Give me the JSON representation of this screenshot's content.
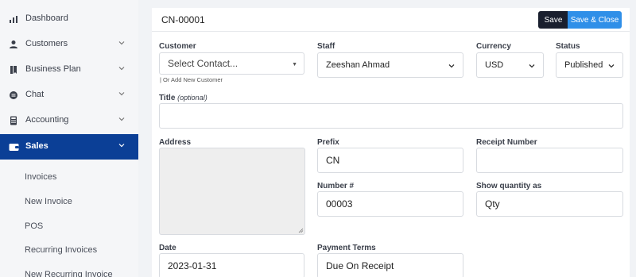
{
  "sidebar": {
    "items": [
      {
        "label": "Dashboard",
        "icon": "bar-chart-icon",
        "has_chevron": false
      },
      {
        "label": "Customers",
        "icon": "user-icon",
        "has_chevron": true
      },
      {
        "label": "Business Plan",
        "icon": "bookmark-icon",
        "has_chevron": true
      },
      {
        "label": "Chat",
        "icon": "chat-icon",
        "has_chevron": true
      },
      {
        "label": "Accounting",
        "icon": "calculator-icon",
        "has_chevron": true
      },
      {
        "label": "Sales",
        "icon": "wallet-icon",
        "has_chevron": true,
        "active": true
      }
    ],
    "sub_items": [
      "Invoices",
      "New Invoice",
      "POS",
      "Recurring Invoices",
      "New Recurring Invoice"
    ]
  },
  "header": {
    "doc_number": "CN-00001",
    "save_label": "Save",
    "save_close_label": "Save & Close"
  },
  "form": {
    "customer": {
      "label": "Customer",
      "placeholder": "Select Contact...",
      "helper": "| Or Add New Customer"
    },
    "staff": {
      "label": "Staff",
      "value": "Zeeshan Ahmad"
    },
    "currency": {
      "label": "Currency",
      "value": "USD"
    },
    "status": {
      "label": "Status",
      "value": "Published"
    },
    "title": {
      "label": "Title",
      "label_suffix": "(optional)",
      "value": ""
    },
    "address": {
      "label": "Address",
      "value": ""
    },
    "prefix": {
      "label": "Prefix",
      "value": "CN"
    },
    "receipt_number": {
      "label": "Receipt Number",
      "value": ""
    },
    "number": {
      "label": "Number #",
      "value": "00003"
    },
    "show_quantity_as": {
      "label": "Show quantity as",
      "value": "Qty"
    },
    "date": {
      "label": "Date",
      "value": "2023-01-31"
    },
    "payment_terms": {
      "label": "Payment Terms",
      "value": "Due On Receipt"
    }
  },
  "colors": {
    "sidebar_active": "#0b3f96",
    "save_button": "#1a1f2e",
    "save_close_button": "#2f8fe8"
  }
}
